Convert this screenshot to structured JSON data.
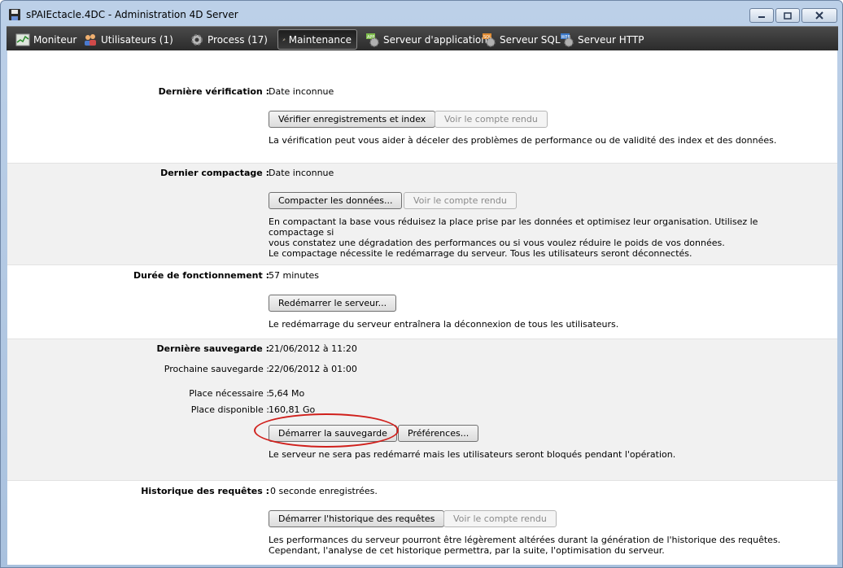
{
  "window": {
    "title": "sPAIEctacle.4DC - Administration 4D Server"
  },
  "toolbar": {
    "tabs": [
      {
        "label": "Moniteur"
      },
      {
        "label": "Utilisateurs (1)"
      },
      {
        "label": "Process (17)"
      },
      {
        "label": "Maintenance"
      },
      {
        "label": "Serveur d'application"
      },
      {
        "label": "Serveur SQL"
      },
      {
        "label": "Serveur HTTP"
      }
    ],
    "active_tab": "Maintenance"
  },
  "verification": {
    "label": "Dernière vérification :",
    "value": "Date inconnue",
    "verify_button": "Vérifier enregistrements et index",
    "report_button": "Voir le compte rendu",
    "description": "La vérification peut vous aider à déceler des problèmes de performance ou de validité des index et des données."
  },
  "compaction": {
    "label": "Dernier compactage :",
    "value": "Date inconnue",
    "compact_button": "Compacter les données...",
    "report_button": "Voir le compte rendu",
    "description_line1": "En compactant la base vous réduisez la place prise par les données et optimisez leur organisation. Utilisez le compactage si",
    "description_line2": "vous constatez une dégradation des performances ou si vous voulez réduire le poids de vos données.",
    "description_line3": "Le compactage nécessite le redémarrage du serveur. Tous les utilisateurs seront déconnectés."
  },
  "uptime": {
    "label": "Durée de fonctionnement :",
    "value": "57 minutes",
    "restart_button": "Redémarrer le serveur...",
    "description": "Le redémarrage du serveur entraînera la déconnexion de tous les utilisateurs."
  },
  "backup": {
    "last_label": "Dernière sauvegarde :",
    "last_value": "21/06/2012 à 11:20",
    "next_label": "Prochaine sauvegarde :",
    "next_value": "22/06/2012 à 01:00",
    "needed_label": "Place nécessaire :",
    "needed_value": "5,64 Mo",
    "available_label": "Place disponible :",
    "available_value": "160,81 Go",
    "start_button": "Démarrer la sauvegarde",
    "prefs_button": "Préférences...",
    "description": "Le serveur ne sera pas redémarré mais les utilisateurs seront bloqués pendant l'opération."
  },
  "request_log": {
    "label": "Historique des requêtes :",
    "value": "0 seconde enregistrées.",
    "start_button": "Démarrer l'historique des requêtes",
    "report_button": "Voir le compte rendu",
    "description_line1": "Les performances du serveur pourront être légèrement altérées durant la génération de l'historique des requêtes.",
    "description_line2": "Cependant, l'analyse de cet historique permettra, par la suite, l'optimisation du serveur."
  },
  "colors": {
    "toolbar_bg": "#333333",
    "section_gray": "#f1f1f1",
    "highlight_ring": "#d0201c"
  }
}
